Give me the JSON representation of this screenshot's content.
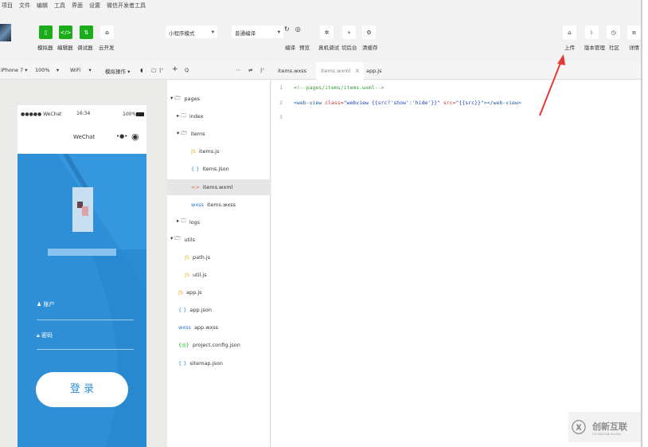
{
  "menu": [
    "项目",
    "文件",
    "编辑",
    "工具",
    "界面",
    "设置",
    "微信开发者工具"
  ],
  "toolbar": {
    "left_buttons": [
      {
        "label": "模拟器",
        "icon": "phone-icon"
      },
      {
        "label": "编辑器",
        "icon": "code-icon"
      },
      {
        "label": "调试器",
        "icon": "debug-icon"
      },
      {
        "label": "云开发",
        "icon": "cloud-icon"
      }
    ],
    "mode_select": "小程序模式",
    "compile_select": "普通编译",
    "actions": [
      {
        "label": "编译",
        "icon": "refresh-icon"
      },
      {
        "label": "预览",
        "icon": "eye-icon"
      },
      {
        "label": "真机调试",
        "icon": "bug-icon"
      },
      {
        "label": "切后台",
        "icon": "switch-icon"
      },
      {
        "label": "清缓存",
        "icon": "cache-icon"
      }
    ],
    "right_actions": [
      {
        "label": "上传",
        "icon": "upload-icon"
      },
      {
        "label": "版本管理",
        "icon": "version-icon"
      },
      {
        "label": "社区",
        "icon": "community-icon"
      },
      {
        "label": "详情",
        "icon": "details-icon"
      }
    ]
  },
  "simulator_bar": {
    "device": "iPhone 7",
    "zoom": "100%",
    "network": "WiFi",
    "operation": "模拟操作"
  },
  "editor_tabs": [
    {
      "label": "items.wxss",
      "active": false
    },
    {
      "label": "items.wxml",
      "active": true,
      "closable": true
    },
    {
      "label": "app.js",
      "active": false
    }
  ],
  "phone": {
    "carrier": "●●●●● WeChat",
    "time": "16:34",
    "battery": "100%",
    "nav_title": "WeChat",
    "account_label": "账户",
    "password_label": "密码",
    "login_button": "登 录"
  },
  "tree": [
    {
      "label": "pages",
      "type": "folder-open",
      "depth": 0
    },
    {
      "label": "index",
      "type": "folder",
      "depth": 1
    },
    {
      "label": "items",
      "type": "folder-open",
      "depth": 1
    },
    {
      "label": "items.js",
      "type": "js",
      "depth": 2
    },
    {
      "label": "items.json",
      "type": "json",
      "depth": 2
    },
    {
      "label": "items.wxml",
      "type": "wxml",
      "depth": 2,
      "selected": true
    },
    {
      "label": "items.wxss",
      "type": "wxss",
      "depth": 2
    },
    {
      "label": "logs",
      "type": "folder",
      "depth": 1
    },
    {
      "label": "utils",
      "type": "folder-open",
      "depth": 0
    },
    {
      "label": "path.js",
      "type": "js",
      "depth": 1
    },
    {
      "label": "util.js",
      "type": "js",
      "depth": 1
    },
    {
      "label": "app.js",
      "type": "js",
      "depth": 0
    },
    {
      "label": "app.json",
      "type": "json",
      "depth": 0
    },
    {
      "label": "app.wxss",
      "type": "wxss",
      "depth": 0
    },
    {
      "label": "project.config.json",
      "type": "config",
      "depth": 0
    },
    {
      "label": "sitemap.json",
      "type": "json",
      "depth": 0
    }
  ],
  "code": {
    "line_numbers": [
      "1",
      "2",
      "3"
    ],
    "line1": "<!--pages/items/items.wxml-->",
    "line2_tag": "<web-view",
    "line2_attr1": "class=",
    "line2_val1": "\"webview {{src?'show':'hide'}}\"",
    "line2_attr2": "src=",
    "line2_val2": "\"{{src}}\"",
    "line2_end": "></web-view>"
  },
  "watermark": {
    "text": "创新互联",
    "sub": "CHUANGXIN HULIAN"
  },
  "colors": {
    "green": "#1aad19",
    "phone_blue": "#2e8fd6",
    "arrow": "#e53935"
  }
}
